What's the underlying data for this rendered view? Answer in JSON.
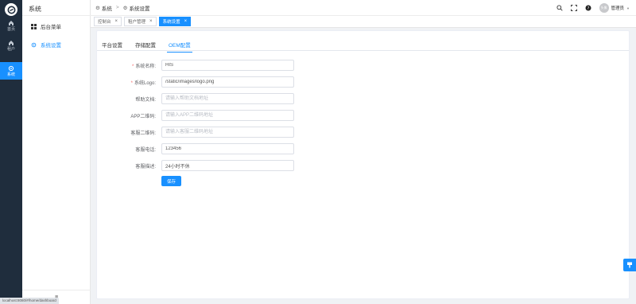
{
  "app": {
    "section_title": "系统"
  },
  "rail": {
    "items": [
      {
        "label": "首页",
        "icon": "home-icon"
      },
      {
        "label": "租户",
        "icon": "home-icon"
      },
      {
        "label": "系统",
        "icon": "gear-icon",
        "active": true
      }
    ]
  },
  "submenu": {
    "items": [
      {
        "label": "后台菜单",
        "icon": "grid-icon"
      },
      {
        "label": "系统设置",
        "icon": "gear-icon",
        "active": true
      }
    ],
    "collapse_icon": "≡"
  },
  "statusbar": {
    "text": "localhost:8080/#/home/dashboard"
  },
  "header": {
    "breadcrumb": [
      "系统",
      "系统设置"
    ],
    "user_name": "管理员",
    "avatar_text": "头像"
  },
  "tabs": [
    {
      "label": "控制台",
      "active": false
    },
    {
      "label": "租户管理",
      "active": false
    },
    {
      "label": "系统设置",
      "active": true
    }
  ],
  "section_tabs": [
    {
      "label": "平台设置",
      "active": false
    },
    {
      "label": "存储配置",
      "active": false
    },
    {
      "label": "OEM配置",
      "active": true
    }
  ],
  "form": {
    "fields": [
      {
        "label": "系统名称:",
        "required": true,
        "value": "HIS",
        "placeholder": ""
      },
      {
        "label": "系统Logo:",
        "required": true,
        "value": "/static/images/logo.png",
        "placeholder": ""
      },
      {
        "label": "帮助文档:",
        "required": false,
        "value": "",
        "placeholder": "请输入帮助文档地址"
      },
      {
        "label": "APP二维码:",
        "required": false,
        "value": "",
        "placeholder": "请输入APP二维码地址"
      },
      {
        "label": "客服二维码:",
        "required": false,
        "value": "",
        "placeholder": "请输入客服二维码地址"
      },
      {
        "label": "客服电话:",
        "required": false,
        "value": "123456",
        "placeholder": ""
      },
      {
        "label": "客服描述:",
        "required": false,
        "value": "24小时不休",
        "placeholder": ""
      }
    ],
    "save_label": "保存"
  },
  "colors": {
    "accent": "#1890ff",
    "rail_bg": "#1f2d3d",
    "required": "#f56c6c"
  }
}
